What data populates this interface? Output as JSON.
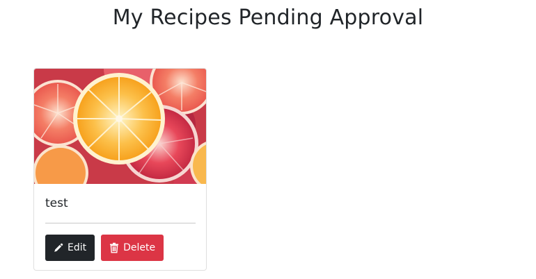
{
  "page": {
    "title": "My Recipes Pending Approval"
  },
  "recipe_card": {
    "image": {
      "alt": "",
      "icon": "citrus-slices-photo"
    },
    "title": "test",
    "edit_label": "Edit",
    "delete_label": "Delete"
  },
  "colors": {
    "edit_button": "#212529",
    "delete_button": "#dc3545",
    "card_border": "#dfdfdf"
  }
}
